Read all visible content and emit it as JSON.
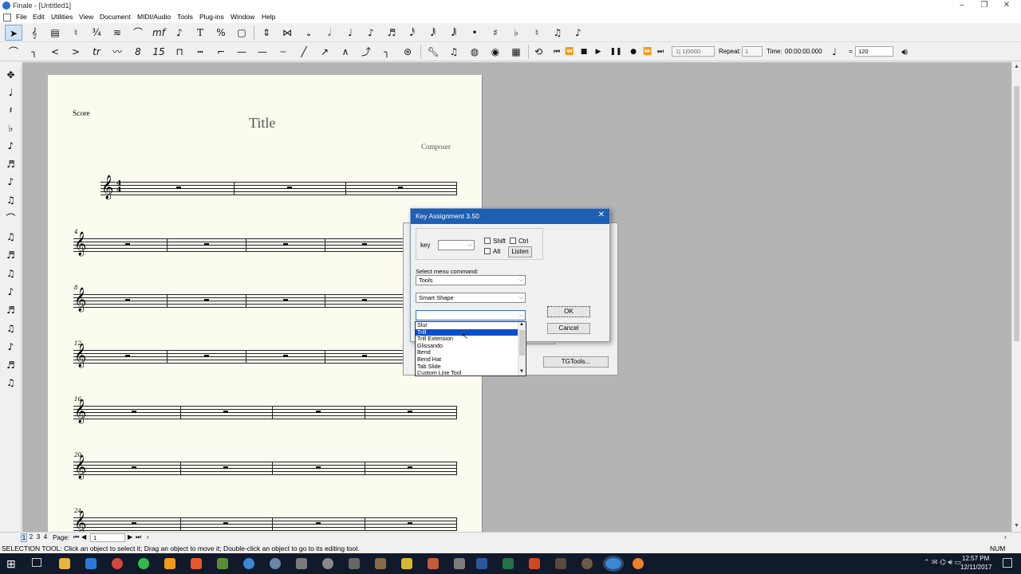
{
  "window": {
    "title": "Finale - [Untitled1]"
  },
  "menu": [
    "File",
    "Edit",
    "Utilities",
    "View",
    "Document",
    "MIDI/Audio",
    "Tools",
    "Plug-ins",
    "Window",
    "Help"
  ],
  "playback": {
    "counter": "1| 1|0000",
    "repeat_label": "Repeat:",
    "repeat_value": "1",
    "time_label": "Time:",
    "time_value": "00:00:00.000",
    "equals": "=",
    "tempo": "120"
  },
  "score": {
    "part_label": "Score",
    "title": "Title",
    "composer": "Composer",
    "measure_numbers": [
      "4",
      "8",
      "12",
      "16",
      "20",
      "24"
    ],
    "time_sig_top": "4",
    "time_sig_bottom": "4"
  },
  "dialog": {
    "title": "Key Assignment 3.50",
    "key_label": "key",
    "shift_label": "Shift",
    "ctrl_label": "Ctrl",
    "alt_label": "Alt",
    "listen_button": "Listen",
    "select_menu_label": "Select menu command:",
    "menu_combo": "Tools",
    "submenu_combo": "Smart Shape",
    "item_combo": "",
    "ok_button": "OK",
    "cancel_button": "Cancel",
    "tgtools_button": "TGTools...",
    "dropdown_items": [
      "Slur",
      "Trill",
      "Trill Extension",
      "Glissando",
      "Bend",
      "Bend Hat",
      "Tab Slide",
      "Custom Line Tool"
    ],
    "dropdown_selected_index": 1
  },
  "pagebar": {
    "page_tabs": [
      "1",
      "2",
      "3",
      "4"
    ],
    "page_label": "Page:",
    "page_value": "1"
  },
  "status": {
    "message": "SELECTION TOOL: Click an object to select it; Drag an object to move it; Double-click an object to go to its editing tool.",
    "num": "NUM"
  },
  "clock": {
    "time": "12:57 PM",
    "date": "12/11/2017"
  },
  "colors": {
    "titlebar_blue": "#1f5fb3",
    "highlight": "#0a50c8",
    "taskbar": "#101a2b",
    "paper": "#fbfbf0"
  }
}
